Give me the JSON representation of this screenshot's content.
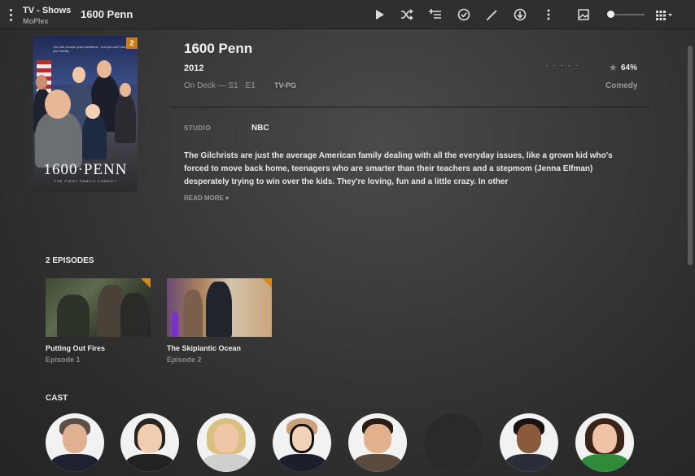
{
  "topbar": {
    "library": "TV - Shows",
    "server": "MoPlex",
    "title": "1600 Penn"
  },
  "show": {
    "title": "1600 Penn",
    "year": "2012",
    "on_deck": "On Deck  — S1 · E1",
    "content_rating": "TV-PG",
    "rating_percent": "64%",
    "genre": "Comedy",
    "studio_label": "STUDIO",
    "studio": "NBC",
    "summary": "The Gilchrists are just the average American family dealing with all the everyday issues, like a grown kid who's forced to move back home, teenagers who are smarter than their teachers and a stepmom (Jenna Elfman) desperately trying to win over the kids. They're loving, fun and a little crazy. In other",
    "read_more": "READ MORE ▾",
    "unwatched_count": "2",
    "poster_title": "1600·PENN",
    "poster_subtitle": "THE FIRST FAMILY COMEDY",
    "poster_tagline": "You can choose your president... but you can't choose your family."
  },
  "episodes": {
    "header": "2 EPISODES",
    "items": [
      {
        "title": "Putting Out Fires",
        "subtitle": "Episode 1"
      },
      {
        "title": "The Skiplantic Ocean",
        "subtitle": "Episode 2"
      }
    ]
  },
  "cast": {
    "header": "CAST"
  },
  "colors": {
    "accent": "#cc7b19",
    "background": "#393939"
  }
}
